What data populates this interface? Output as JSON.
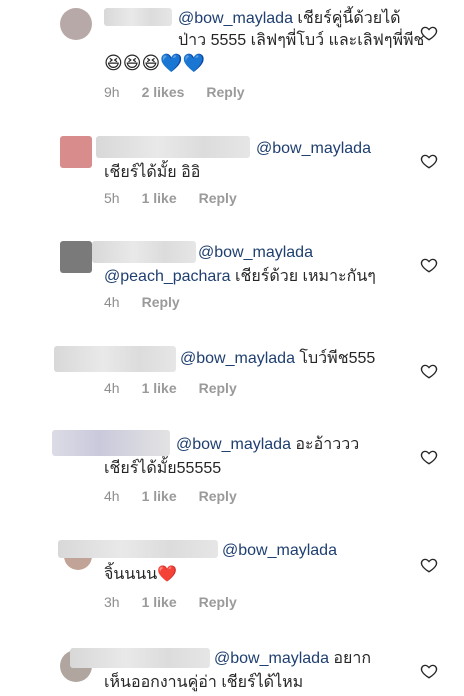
{
  "heart_icon": "heart-outline",
  "comments": [
    {
      "mention": "@bow_maylada",
      "text": "เชียร์คู่นี้ด้วยได้ป่าว 5555 เลิฟๆพี่โบว์ และเลิฟๆพี่พีช",
      "emojis": "😆😆😆💙💙",
      "time": "9h",
      "likes": "2 likes",
      "reply": "Reply"
    },
    {
      "mention": "@bow_maylada",
      "text": "เชียร์ได้มั้ย อิอิ",
      "time": "5h",
      "likes": "1 like",
      "reply": "Reply"
    },
    {
      "mention": "@bow_maylada",
      "mention2": "@peach_pachara",
      "text": "เชียร์ด้วย เหมาะกันๆ",
      "time": "4h",
      "reply": "Reply"
    },
    {
      "mention": "@bow_maylada",
      "text": "โบว์พีช555",
      "time": "4h",
      "likes": "1 like",
      "reply": "Reply"
    },
    {
      "mention": "@bow_maylada",
      "text": "อะอ้าววว",
      "text2": "เชียร์ได้มั้ย55555",
      "time": "4h",
      "likes": "1 like",
      "reply": "Reply"
    },
    {
      "mention": "@bow_maylada",
      "text": "จิ้นนนน❤️",
      "time": "3h",
      "likes": "1 like",
      "reply": "Reply"
    },
    {
      "mention": "@bow_maylada",
      "text": "อยาก",
      "text2": "เห็นออกงานคู่อ่า เชียร์ได้ไหม"
    }
  ]
}
